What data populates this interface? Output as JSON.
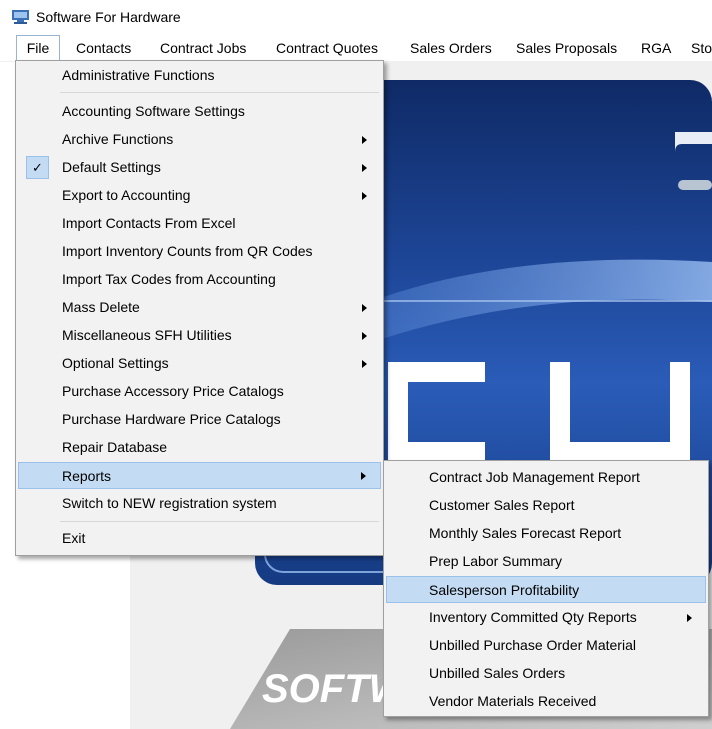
{
  "window": {
    "title": "Software For Hardware"
  },
  "menubar": {
    "items": [
      {
        "label": "File"
      },
      {
        "label": "Contacts"
      },
      {
        "label": "Contract Jobs"
      },
      {
        "label": "Contract Quotes"
      },
      {
        "label": "Sales Orders"
      },
      {
        "label": "Sales Proposals"
      },
      {
        "label": "RGA"
      },
      {
        "label": "Sto"
      }
    ]
  },
  "file_menu": {
    "items": [
      {
        "label": "Administrative Functions",
        "submenu": false
      },
      {
        "label": "Accounting Software Settings",
        "submenu": false
      },
      {
        "label": "Archive Functions",
        "submenu": true
      },
      {
        "label": "Default Settings",
        "submenu": true,
        "checked": true
      },
      {
        "label": "Export to Accounting",
        "submenu": true
      },
      {
        "label": "Import Contacts From Excel",
        "submenu": false
      },
      {
        "label": "Import Inventory Counts from QR Codes",
        "submenu": false
      },
      {
        "label": "Import Tax Codes from Accounting",
        "submenu": false
      },
      {
        "label": "Mass Delete",
        "submenu": true
      },
      {
        "label": "Miscellaneous SFH Utilities",
        "submenu": true
      },
      {
        "label": "Optional Settings",
        "submenu": true
      },
      {
        "label": "Purchase Accessory Price Catalogs",
        "submenu": false
      },
      {
        "label": "Purchase Hardware Price Catalogs",
        "submenu": false
      },
      {
        "label": "Repair Database",
        "submenu": false
      },
      {
        "label": "Reports",
        "submenu": true,
        "highlighted": true
      },
      {
        "label": "Switch to NEW registration system",
        "submenu": false
      },
      {
        "label": "Exit",
        "submenu": false
      }
    ]
  },
  "reports_menu": {
    "items": [
      {
        "label": "Contract Job Management Report",
        "submenu": false
      },
      {
        "label": "Customer Sales Report",
        "submenu": false
      },
      {
        "label": "Monthly Sales Forecast Report",
        "submenu": false
      },
      {
        "label": "Prep Labor Summary",
        "submenu": false
      },
      {
        "label": "Salesperson Profitability",
        "submenu": false,
        "highlighted": true
      },
      {
        "label": "Inventory Committed Qty Reports",
        "submenu": true
      },
      {
        "label": "Unbilled Purchase Order Material",
        "submenu": false
      },
      {
        "label": "Unbilled Sales Orders",
        "submenu": false
      },
      {
        "label": "Vendor Materials Received",
        "submenu": false
      }
    ]
  },
  "splash": {
    "visible_text": "SOFTW"
  },
  "colors": {
    "highlight": "#c4dcf3",
    "highlight_border": "#99c1ea",
    "menu_bg": "#f2f2f2",
    "splash_blue": "#1f4a96"
  },
  "icons": {
    "app": "computer-app-icon",
    "check": "checkmark-icon",
    "submenu": "submenu-arrow-icon"
  }
}
